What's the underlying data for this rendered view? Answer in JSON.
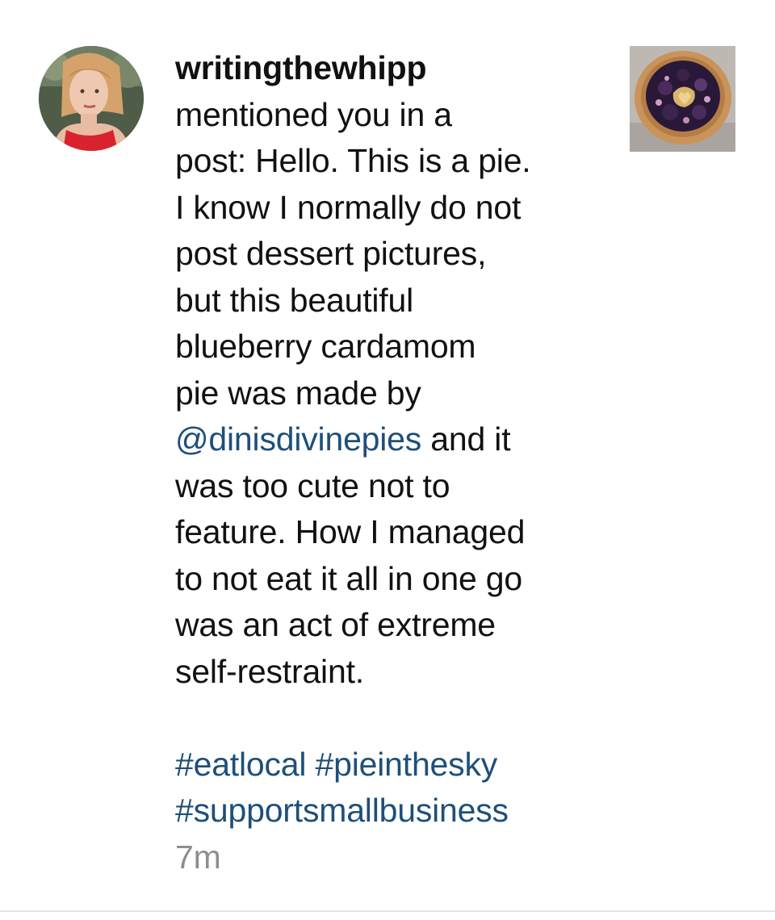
{
  "notification": {
    "username": "writingthewhipp",
    "message_lines": [
      "mentioned you in a",
      "post: Hello. This is a pie.",
      "I know I normally do not",
      "post dessert pictures,",
      "but this beautiful",
      "blueberry cardamom",
      "pie was made by"
    ],
    "mention": "@dinisdivinepies",
    "after_mention": " and it",
    "message_lines_2": [
      "was too cute not to",
      "feature. How I managed",
      "to not eat it all in one go",
      "was an act of extreme",
      "self-restraint."
    ],
    "hashtags": [
      "#eatlocal",
      "#pieinthesky",
      "#supportsmallbusiness"
    ],
    "timestamp": "7m",
    "link_color": "#1e4f7a",
    "timestamp_color": "#8e8e8e"
  }
}
